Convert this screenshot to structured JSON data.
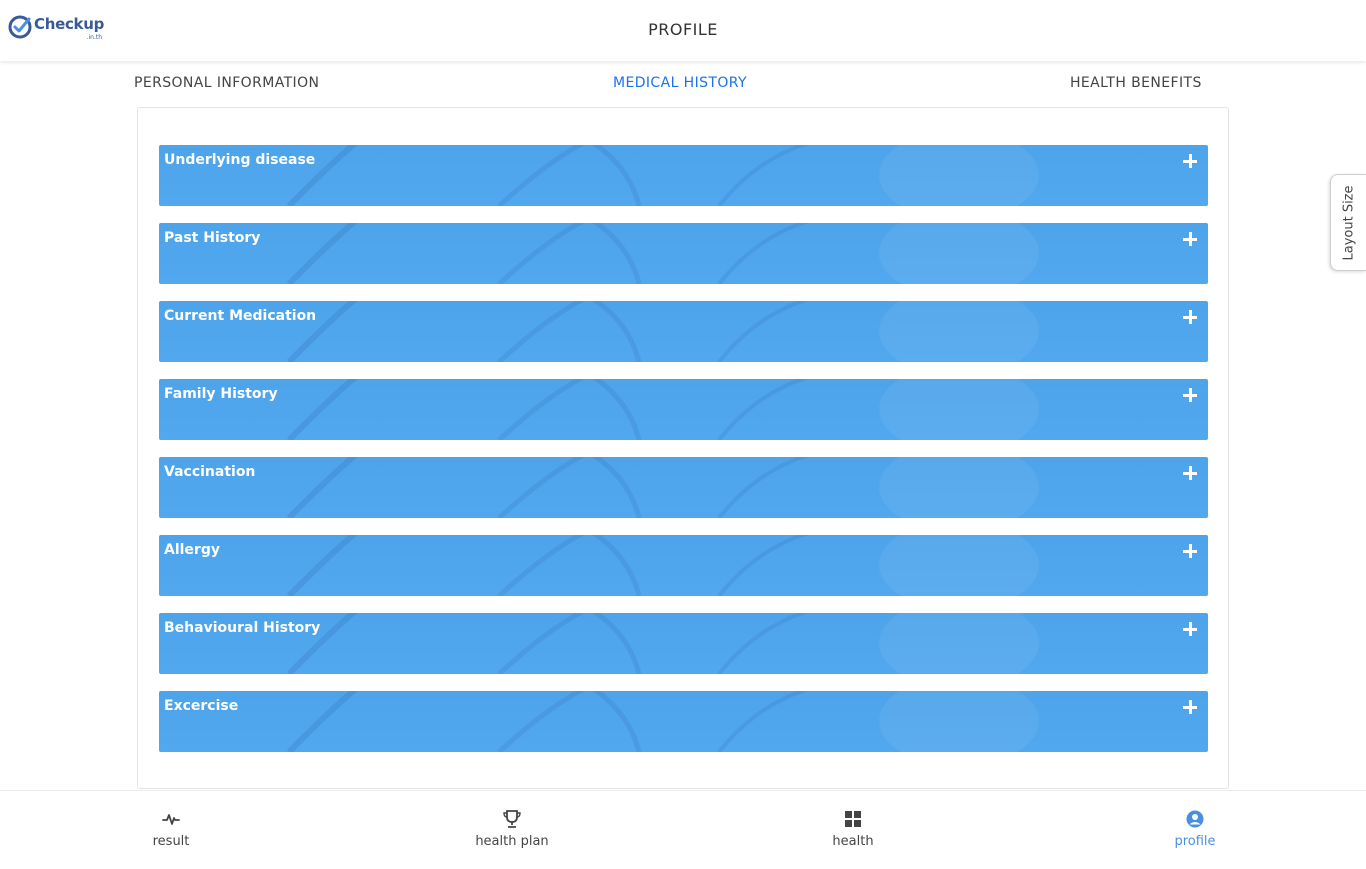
{
  "brand": {
    "name": "Checkup",
    "suffix": ".in.th"
  },
  "header": {
    "title": "PROFILE"
  },
  "tabs": [
    {
      "label": "PERSONAL INFORMATION",
      "active": false
    },
    {
      "label": "MEDICAL HISTORY",
      "active": true
    },
    {
      "label": "HEALTH BENEFITS",
      "active": false
    }
  ],
  "sections": [
    {
      "label": "Underlying disease",
      "icon": "plus-icon"
    },
    {
      "label": "Past History",
      "icon": "plus-icon"
    },
    {
      "label": "Current Medication",
      "icon": "plus-icon"
    },
    {
      "label": "Family History",
      "icon": "plus-icon"
    },
    {
      "label": "Vaccination",
      "icon": "plus-icon"
    },
    {
      "label": "Allergy",
      "icon": "plus-icon"
    },
    {
      "label": "Behavioural History",
      "icon": "plus-icon"
    },
    {
      "label": "Excercise",
      "icon": "plus-icon"
    }
  ],
  "side_tab": {
    "label": "Layout Size"
  },
  "bottom_nav": [
    {
      "label": "result",
      "icon": "pulse-icon",
      "active": false
    },
    {
      "label": "health plan",
      "icon": "trophy-icon",
      "active": false
    },
    {
      "label": "health",
      "icon": "grid-icon",
      "active": false
    },
    {
      "label": "profile",
      "icon": "user-circle-icon",
      "active": true
    }
  ],
  "colors": {
    "accent": "#4a90e2",
    "section_bg": "#4da4ea",
    "active_tab": "#1a73e8",
    "brand": "#3a5a97"
  }
}
